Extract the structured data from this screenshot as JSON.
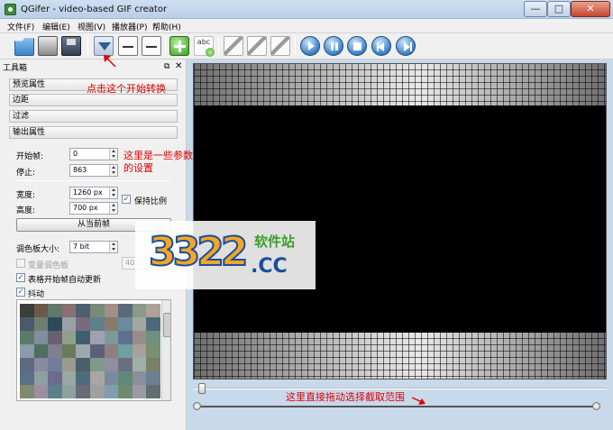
{
  "window": {
    "title": "QGifer - video-based GIF creator",
    "minimize_glyph": "—",
    "maximize_glyph": "□",
    "close_glyph": "✕"
  },
  "menu": [
    "文件(F)",
    "编辑(E)",
    "视图(V)",
    "播放器(P)",
    "帮助(H)"
  ],
  "toolbar": {
    "icons": [
      "open-folder-icon",
      "print-icon",
      "save-icon",
      "convert-icon",
      "set-start-icon",
      "set-end-icon",
      "add-object-icon",
      "text-icon",
      "draw-icon",
      "play-icon",
      "pause-icon",
      "stop-icon",
      "prev-icon",
      "next-icon"
    ],
    "text_icon_label": "abc"
  },
  "toolbox": {
    "title": "工具箱",
    "float_glyph": "⧉",
    "close_glyph": "✕",
    "sections": [
      "预览属性",
      "边距",
      "过滤",
      "输出属性"
    ],
    "start_frame_label": "开始帧:",
    "start_frame_value": "0",
    "stop_label": "停止:",
    "stop_value": "863",
    "width_label": "宽度:",
    "width_value": "1260 px",
    "height_label": "高度:",
    "height_value": "700 px",
    "keep_ratio_label": "保持比例",
    "keep_ratio_checked": true,
    "from_current_button": "从当前帧",
    "palette_size_label": "调色板大小:",
    "palette_size_value": "7 bit",
    "variable_palette_label": "变量调色板",
    "variable_palette_value": "40.00",
    "auto_update_label": "表格开始帧自动更新",
    "auto_update_checked": true,
    "dither_label": "抖动",
    "dither_checked": true,
    "check_glyph": "✓",
    "palette_colors": [
      "#3b3f3a",
      "#6a5a4c",
      "#5f7a6b",
      "#8a6f73",
      "#4f5f70",
      "#7a8a7a",
      "#a08f8a",
      "#5a6a78",
      "#8a9a8a",
      "#b0a09a",
      "#4a5a6a",
      "#6f7f6f",
      "#2d4a5a",
      "#9aa0a8",
      "#7a6a80",
      "#5f7f8a",
      "#8a7a6a",
      "#6a8aa0",
      "#a0a8a0",
      "#4a6a7a",
      "#5a7a6a",
      "#7f8f9f",
      "#6a5f6f",
      "#8f9f8a",
      "#3f5f6f",
      "#a0a0b0",
      "#7a9a9a",
      "#5f6f8f",
      "#9a8a8a",
      "#6f8f7f",
      "#8a9aa8",
      "#4f6f5f",
      "#7f7f8f",
      "#6a7a5a",
      "#9fa8b0",
      "#5a5f7a",
      "#8f7f7f",
      "#6f9f9f",
      "#a8a09a",
      "#7a8f6f",
      "#5f6a7f",
      "#8a8aa0",
      "#6f7f9a",
      "#9a9a8f",
      "#4a5f6a",
      "#7f9a8a",
      "#8f8fa0",
      "#6a6f7f",
      "#a0b0a8",
      "#7a7f6a",
      "#5a6f8a",
      "#8f9fa0",
      "#6f6a8f",
      "#9aa8a0",
      "#4f6a7f",
      "#a8a8a0",
      "#7a8aa0",
      "#5f8a7a",
      "#8a8f9a",
      "#6a7f8f",
      "#7f8a6f",
      "#9a8fa0",
      "#5a7f8f",
      "#8fa0a0",
      "#6a6a7a",
      "#a0a0a0",
      "#7f9faf",
      "#6f8a6f",
      "#9a9aa8",
      "#5f6f6f"
    ]
  },
  "annotations": {
    "start_convert": "点击这个开始转换",
    "params_line1": "这里是一些参数",
    "params_line2": "的设置",
    "range_hint": "这里直接拖动选择截取范围"
  },
  "watermark": {
    "digits": "3322",
    "name": "软件站",
    "domain": ".CC"
  }
}
